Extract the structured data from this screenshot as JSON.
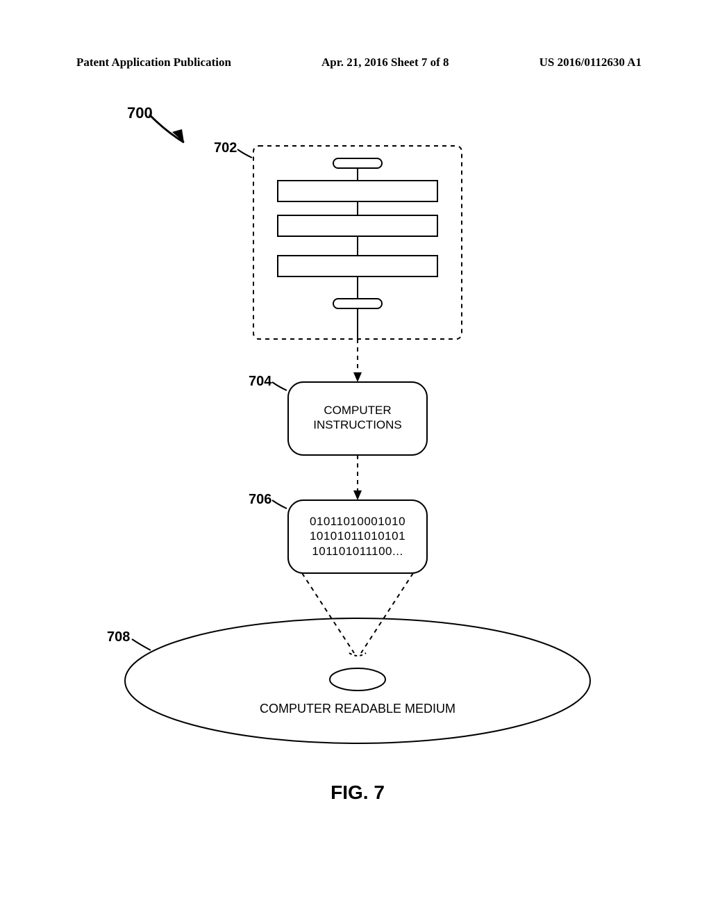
{
  "header": {
    "left": "Patent Application Publication",
    "center": "Apr. 21, 2016  Sheet 7 of 8",
    "right": "US 2016/0112630 A1"
  },
  "labels": {
    "l700": "700",
    "l702": "702",
    "l704": "704",
    "l706": "706",
    "l708": "708"
  },
  "box704": {
    "line1": "COMPUTER",
    "line2": "INSTRUCTIONS"
  },
  "box706": {
    "line1": "01011010001010",
    "line2": "10101011010101",
    "line3": "101101011100..."
  },
  "disc": {
    "text": "COMPUTER READABLE MEDIUM"
  },
  "figure_caption": "FIG. 7"
}
